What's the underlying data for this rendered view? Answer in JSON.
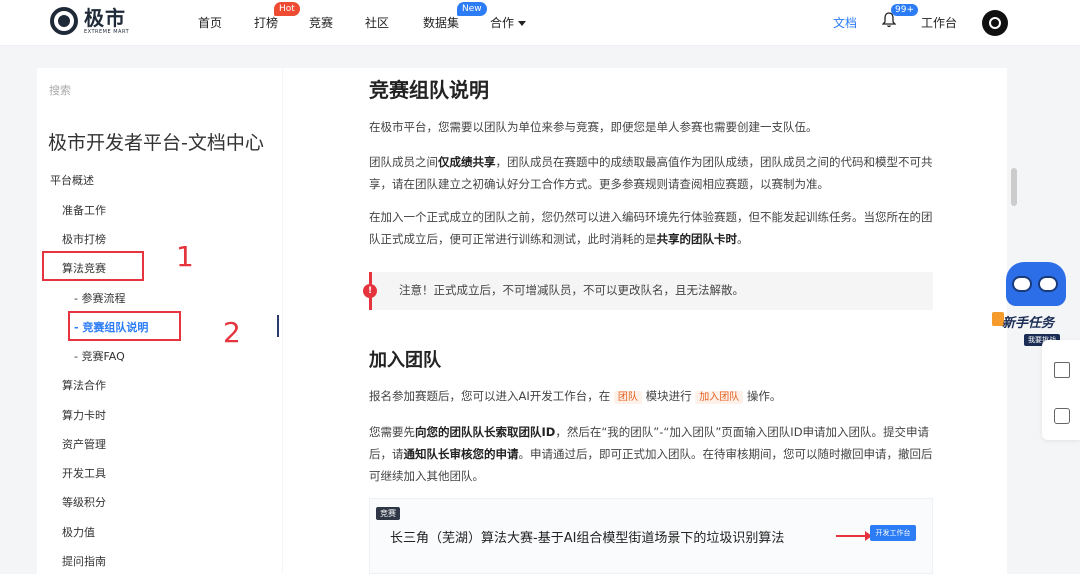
{
  "header": {
    "logo_cn": "极市",
    "logo_en": "EXTREME MART",
    "nav": [
      {
        "label": "首页"
      },
      {
        "label": "打榜",
        "badge": "Hot"
      },
      {
        "label": "竞赛"
      },
      {
        "label": "社区"
      },
      {
        "label": "数据集",
        "badge": "New"
      },
      {
        "label": "合作",
        "dropdown": true
      }
    ],
    "docs": "文档",
    "notification_count": "99+",
    "workbench": "工作台"
  },
  "sidebar": {
    "search_placeholder": "搜索",
    "title": "极市开发者平台-文档中心",
    "items": [
      {
        "label": "平台概述"
      },
      {
        "label": "准备工作"
      },
      {
        "label": "极市打榜"
      },
      {
        "label": "算法竞赛"
      },
      {
        "label": "- 参赛流程"
      },
      {
        "label": "- 竞赛组队说明",
        "active": true
      },
      {
        "label": "- 竞赛FAQ"
      },
      {
        "label": "算法合作"
      },
      {
        "label": "算力卡时"
      },
      {
        "label": "资产管理"
      },
      {
        "label": "开发工具"
      },
      {
        "label": "等级积分"
      },
      {
        "label": "极力值"
      },
      {
        "label": "提问指南"
      }
    ],
    "annotations": [
      "1",
      "2"
    ]
  },
  "main": {
    "title": "竞赛组队说明",
    "p1": "在极市平台，您需要以团队为单位来参与竞赛，即便您是单人参赛也需要创建一支队伍。",
    "p2_a": "团队成员之间",
    "p2_b": "仅成绩共享",
    "p2_c": "，团队成员在赛题中的成绩取最高值作为团队成绩，团队成员之间的代码和模型不可共享，请在团队建立之初确认好分工合作方式。更多参赛规则请查阅相应赛题，以赛制为准。",
    "p3_a": "在加入一个正式成立的团队之前，您仍然可以进入编码环境先行体验赛题，但不能发起训练任务。当您所在的团队正式成立后，便可正常进行训练和测试，此时消耗的是",
    "p3_b": "共享的团队卡时",
    "p3_c": "。",
    "notice": "注意！正式成立后，不可增减队员，不可以更改队名，且无法解散。",
    "h2": "加入团队",
    "p4_a": "报名参加赛题后，您可以进入AI开发工作台，在",
    "p4_tag1": "团队",
    "p4_b": "模块进行",
    "p4_tag2": "加入团队",
    "p4_c": "操作。",
    "p5_a": "您需要先",
    "p5_b": "向您的团队队长索取团队ID",
    "p5_c": "，然后在“我的团队”-“加入团队”页面输入团队ID申请加入团队。提交申请后，请",
    "p5_d": "通知队长审核您的申请",
    "p5_e": "。申请通过后，即可正式加入团队。在待审核期间，您可以随时撤回申请，撤回后可继续加入其他团队。",
    "shot_tag": "竞赛",
    "shot_title": "长三角（芜湖）算法大赛-基于AI组合模型街道场景下的垃圾识别算法",
    "shot_button": "开发工作台"
  },
  "promo": {
    "title": "新手任务",
    "sub": "我要挑战"
  }
}
